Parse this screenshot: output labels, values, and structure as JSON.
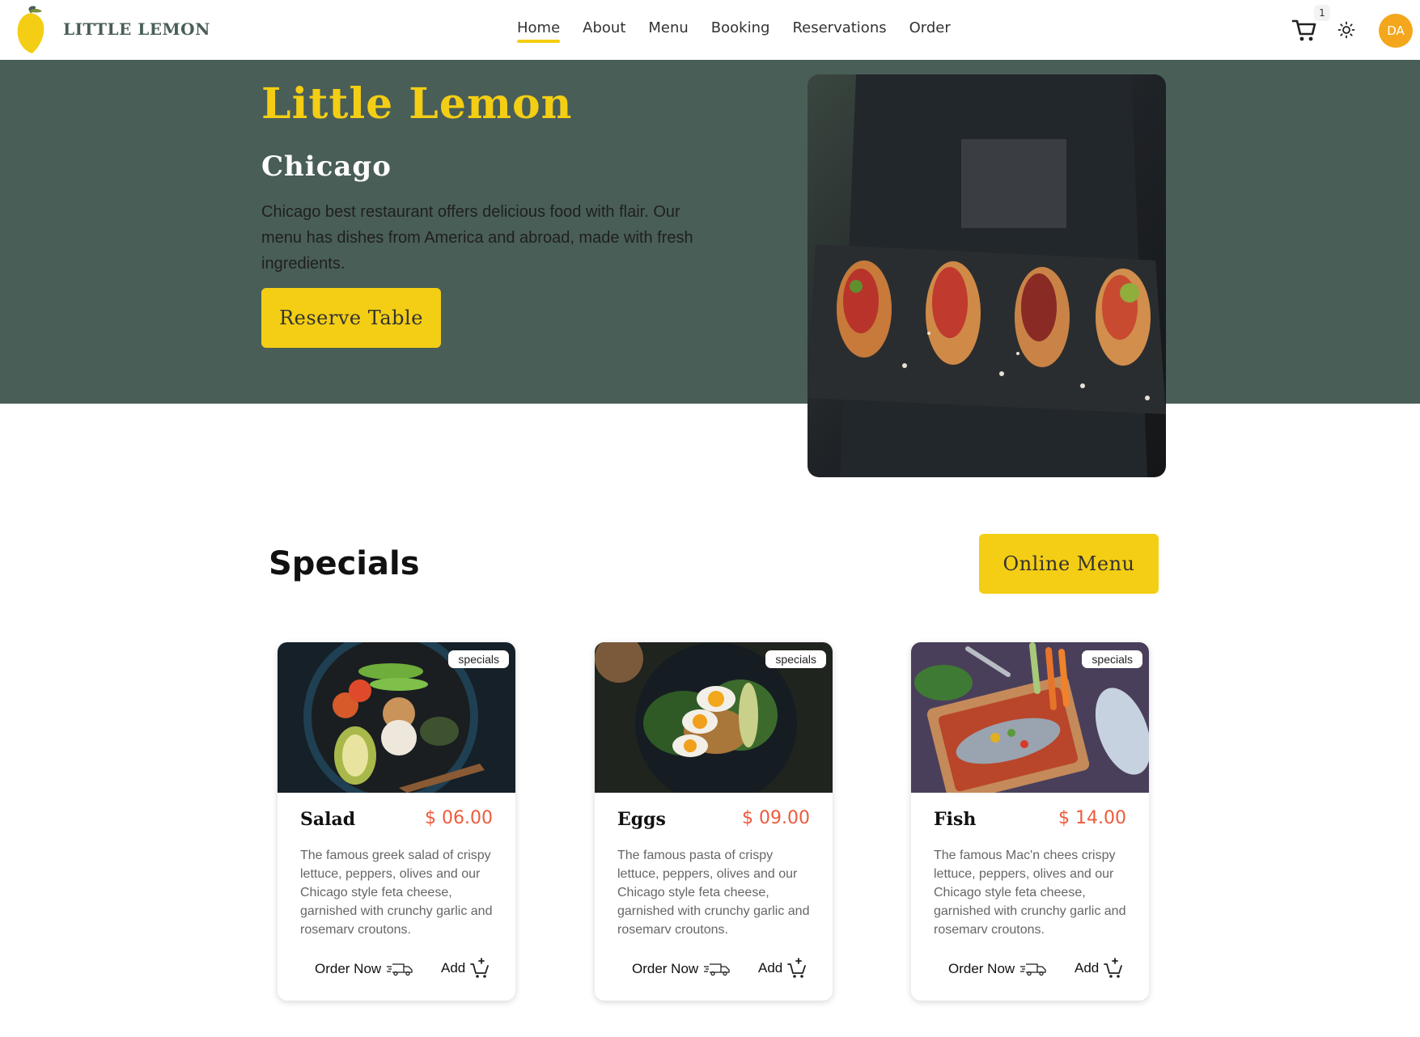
{
  "header": {
    "brand": "LITTLE LEMON",
    "logo_icon": "lemon-logo",
    "nav": [
      {
        "label": "Home",
        "active": true
      },
      {
        "label": "About"
      },
      {
        "label": "Menu"
      },
      {
        "label": "Booking"
      },
      {
        "label": "Reservations"
      },
      {
        "label": "Order"
      }
    ],
    "cart_count": "1",
    "cart_icon": "cart-icon",
    "theme_icon": "sun-icon",
    "avatar_initials": "DA"
  },
  "hero": {
    "title": "Little Lemon",
    "subtitle": "Chicago",
    "description": "Chicago best restaurant offers delicious food with flair. Our menu has dishes from America and abroad, made with fresh ingredients.",
    "cta_label": "Reserve Table"
  },
  "specials": {
    "title": "Specials",
    "menu_button": "Online Menu",
    "cards": [
      {
        "badge": "specials",
        "name": "Salad",
        "price": "$ 06.00",
        "description": "The famous greek salad of crispy lettuce, peppers, olives and our Chicago style feta cheese, garnished with crunchy garlic and rosemarv croutons.",
        "order_label": "Order Now",
        "add_label": "Add"
      },
      {
        "badge": "specials",
        "name": "Eggs",
        "price": "$ 09.00",
        "description": "The famous pasta of crispy lettuce, peppers, olives and our Chicago style feta cheese, garnished with crunchy garlic and rosemarv croutons.",
        "order_label": "Order Now",
        "add_label": "Add"
      },
      {
        "badge": "specials",
        "name": "Fish",
        "price": "$ 14.00",
        "description": "The famous Mac'n chees crispy lettuce, peppers, olives and our Chicago style feta cheese, garnished with crunchy garlic and rosemarv croutons.",
        "order_label": "Order Now",
        "add_label": "Add"
      }
    ]
  },
  "colors": {
    "primary_green": "#495e57",
    "primary_yellow": "#f4ce14",
    "price_red": "#ee5a3c",
    "avatar_orange": "#f4a71c"
  }
}
